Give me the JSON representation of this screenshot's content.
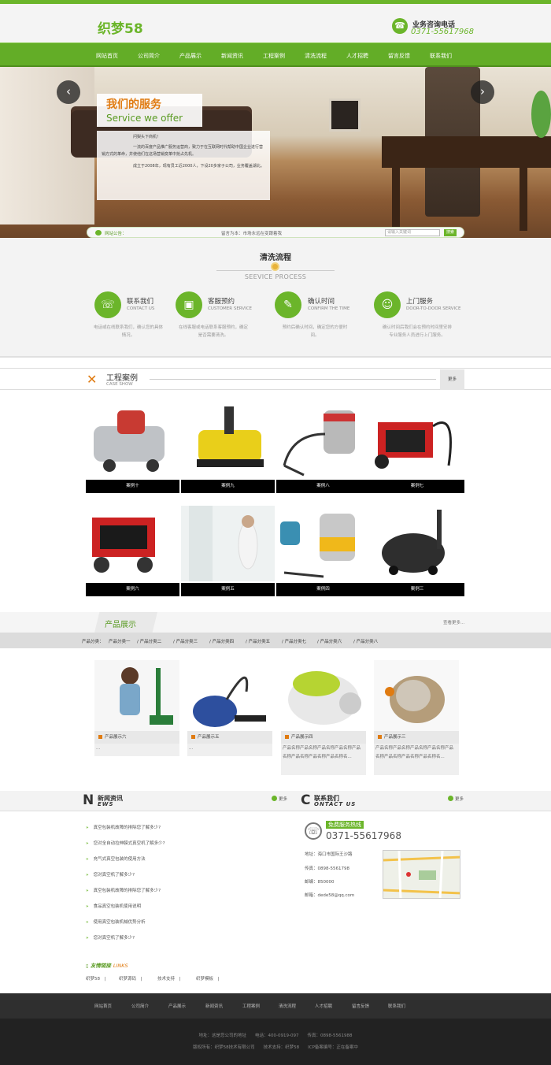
{
  "header": {
    "logo": "织梦58",
    "hotline_label": "业务咨询电话",
    "hotline_number": "0371-55617968",
    "brand_color": "#6bb52a"
  },
  "nav": [
    "网站首页",
    "公司简介",
    "产品展示",
    "新闻资讯",
    "工程案例",
    "清洗流程",
    "人才招聘",
    "留言反馈",
    "联系我们"
  ],
  "banner": {
    "title_cn": "我们的服务",
    "title_en": "Service we offer",
    "para1": "问梨头下商机！",
    "para2": "一流的百度产品推广服务运营商，致力于在互联网时代帮助中国企业进行营销方式的革命，并使他们在这场营销变革中抢占先机。",
    "para3": "成立于2008年，现有员工近2000人，下设20多家子公司，业务覆盖湖北。",
    "notice_label": "网站公告：",
    "notice_text": "留言为本：市场永远在变跟着我",
    "search_placeholder": "请输入关键词",
    "search_button": "搜索"
  },
  "process": {
    "title": "清洗流程",
    "subtitle": "SEEVICE PROCESS",
    "steps": [
      {
        "cn": "联系我们",
        "en": "CONTACT US",
        "desc": "电话或在线联系我们，确认您的具体情况。"
      },
      {
        "cn": "客服预约",
        "en": "CUSTOMER SERVICE",
        "desc": "在线客服或电话联系客服预约，确定是否需要清洗。"
      },
      {
        "cn": "确认时间",
        "en": "CONFIRM THE TIME",
        "desc": "预约后确认时间，确定您的方便时间。"
      },
      {
        "cn": "上门服务",
        "en": "DOOR-TO-DOOR SERVICE",
        "desc": "确认时间后我们会在预约时间里安排专业服务人员进行上门服务。"
      }
    ]
  },
  "cases": {
    "title_cn": "工程案例",
    "title_en": "CASE SHOW",
    "more": "更多",
    "items": [
      "案例十",
      "案例九",
      "案例八",
      "案例七",
      "案例六",
      "案例五",
      "案例四",
      "案例三"
    ]
  },
  "products": {
    "title_cn": "产品展示",
    "more": "查看更多...",
    "cat_label": "产品分类：",
    "categories": [
      "产品分类一",
      "产品分类二",
      "产品分类三",
      "产品分类四",
      "产品分类五",
      "产品分类七",
      "产品分类六",
      "产品分类八"
    ],
    "items": [
      {
        "name": "产品展示六",
        "desc": "..."
      },
      {
        "name": "产品展示五",
        "desc": "..."
      },
      {
        "name": "产品展示四",
        "desc": "产品名称产品名称产品名称产品名称产品名称产品名称产品名称产品名称名..."
      },
      {
        "name": "产品展示三",
        "desc": "产品名称产品名称产品名称产品名称产品名称产品名称产品名称产品名称名..."
      }
    ]
  },
  "news": {
    "title_cn": "新闻资讯",
    "title_en": "EWS",
    "more": "更多",
    "items": [
      "真空包装机故障的排除您了解多少?",
      "您对全自动拉伸膜式真空机了解多少?",
      "充气式真空包装的使用方法",
      "您对真空机了解多少?",
      "真空包装机故障的排除您了解多少?",
      "食品真空包装机使用说明",
      "使用真空包装机械优势分析",
      "您对真空机了解多少?"
    ]
  },
  "contact": {
    "title_cn": "联系我们",
    "title_en": "ONTACT US",
    "more": "更多",
    "badge": "免费服务热线",
    "phone": "0371-55617968",
    "address": "地址：海口市国际王沙路",
    "fax": "传真：0898-5561798",
    "zip": "邮编：850000",
    "email": "邮箱：dede58@qq.com"
  },
  "links": {
    "title": "友情链接",
    "title_en": "LINKS",
    "items": [
      "织梦58",
      "织梦源码",
      "技术支持",
      "织梦模板"
    ]
  },
  "footer": {
    "nav": [
      "网站首页",
      "公司简介",
      "产品展示",
      "新闻资讯",
      "工程案例",
      "清洗流程",
      "人才招聘",
      "留言反馈",
      "联系我们"
    ],
    "line1": "地址：这是您公司的地址　　电话：400-0919-097　　传真：0898-5561988",
    "line2": "版权所有：织梦58技术有限公司　　技术支持：织梦58　　ICP备案编号：正在备案中"
  }
}
